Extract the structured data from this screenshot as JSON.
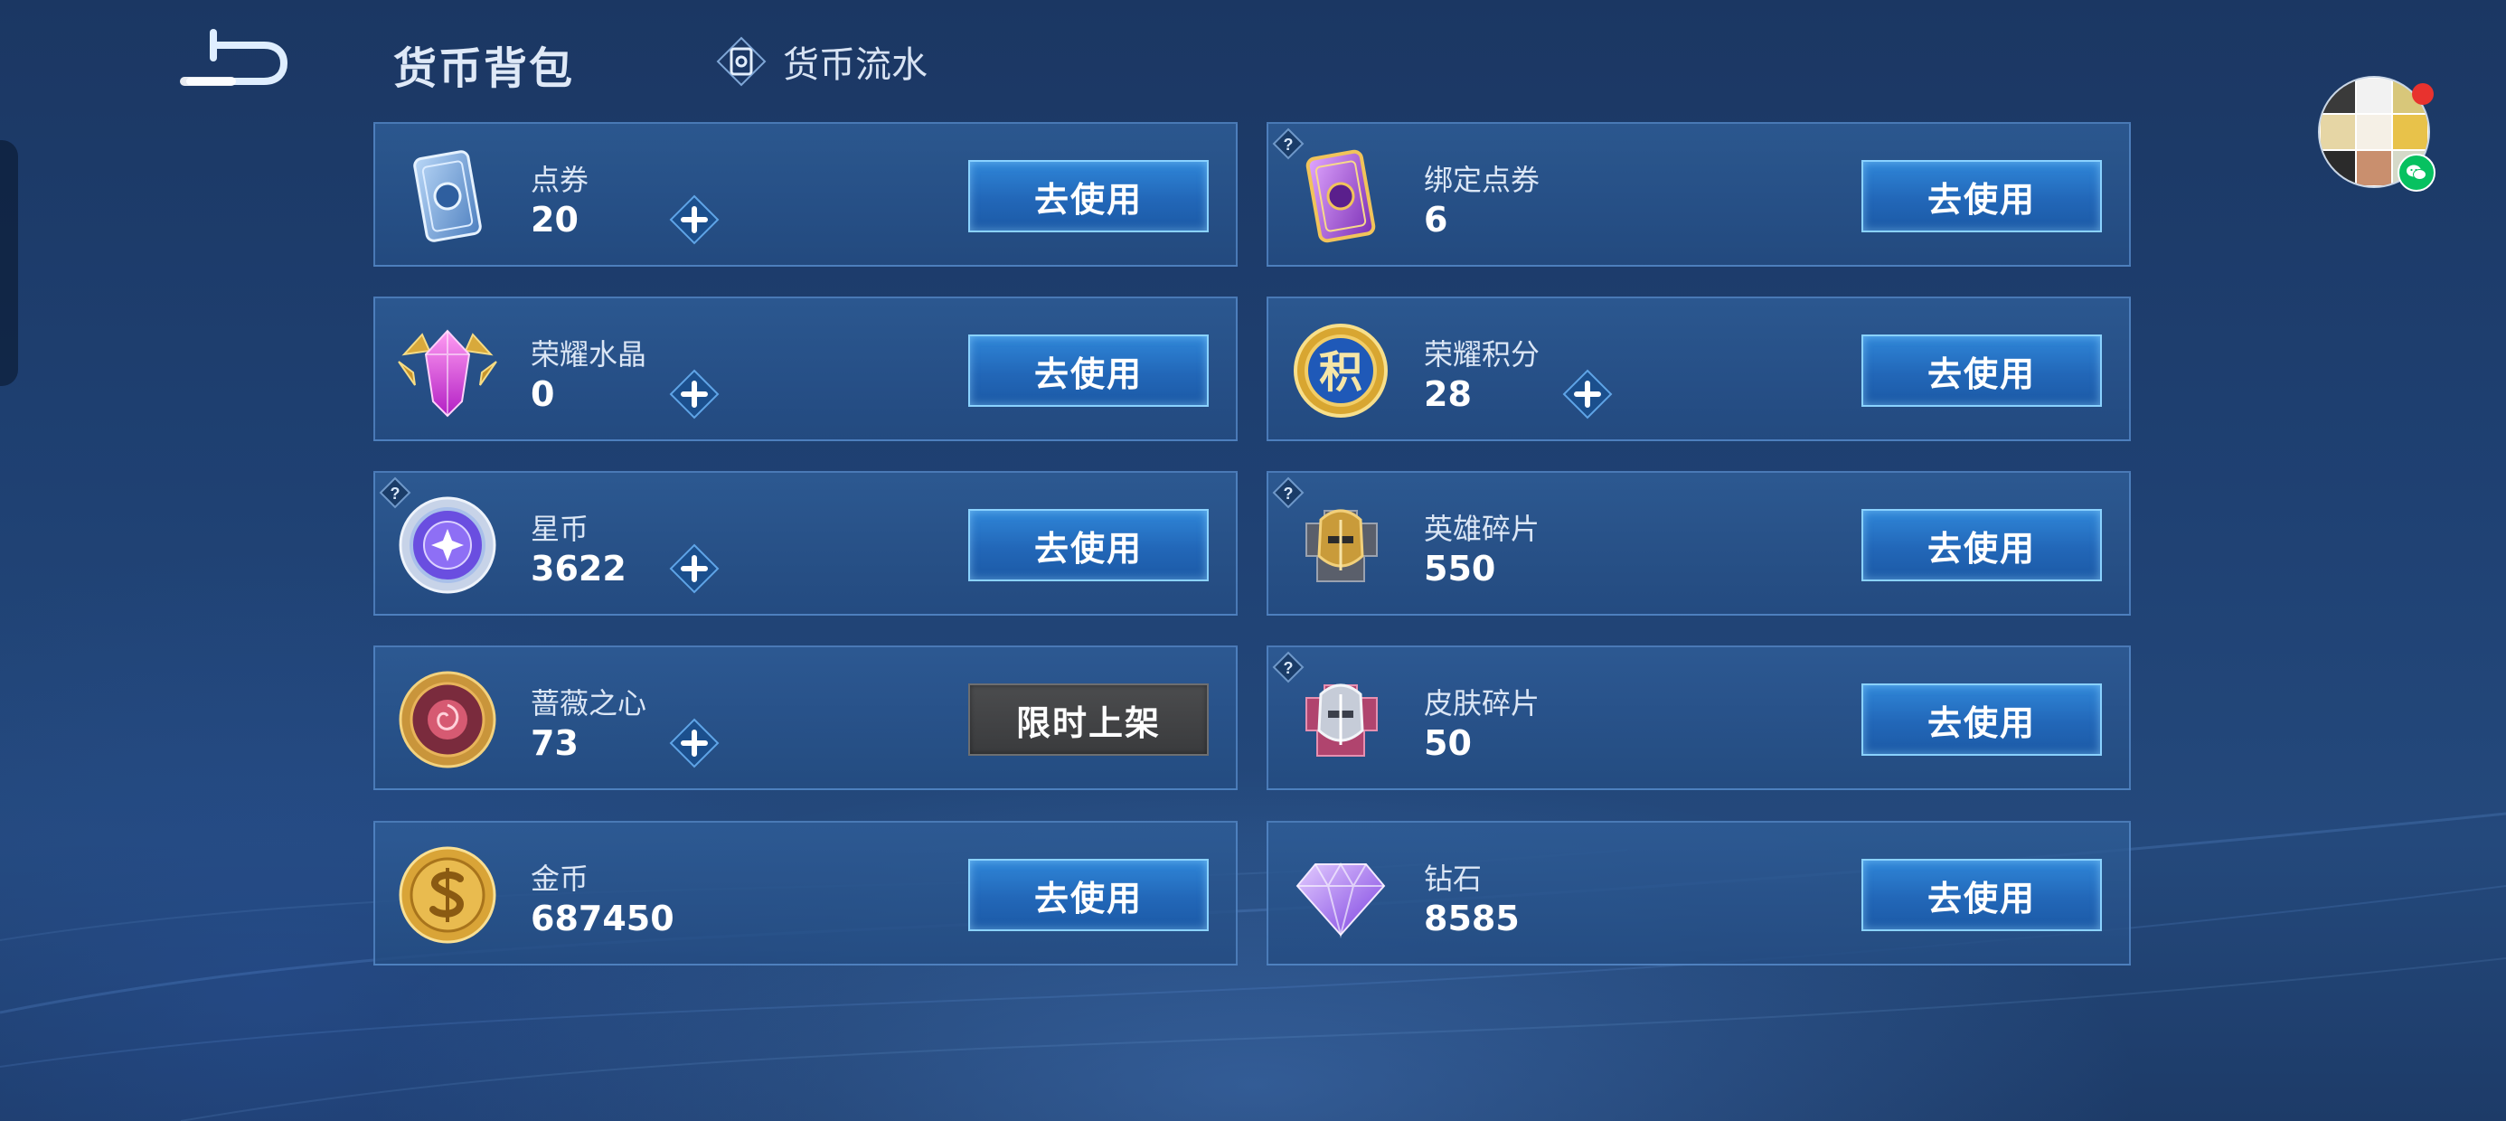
{
  "header": {
    "title": "货币背包",
    "ledger_label": "货币流水"
  },
  "colors": {
    "button_blue": "#2267b8",
    "button_border": "#8ad2ff",
    "limited_button": "#3a3b3d",
    "card_bg": "#2a5690",
    "notification_dot": "#e8322e",
    "wechat_green": "#07c160"
  },
  "currencies": [
    {
      "name": "点券",
      "amount": "20",
      "button": "去使用",
      "icon": "ticket-icon"
    },
    {
      "name": "绑定点券",
      "amount": "6",
      "button": "去使用",
      "icon": "bound-ticket-icon"
    },
    {
      "name": "荣耀水晶",
      "amount": "0",
      "button": "去使用",
      "icon": "glory-crystal-icon"
    },
    {
      "name": "荣耀积分",
      "amount": "28",
      "button": "去使用",
      "icon": "glory-points-icon"
    },
    {
      "name": "星币",
      "amount": "3622",
      "button": "去使用",
      "icon": "star-coin-icon"
    },
    {
      "name": "英雄碎片",
      "amount": "550",
      "button": "去使用",
      "icon": "hero-fragment-icon"
    },
    {
      "name": "蔷薇之心",
      "amount": "73",
      "button": "限时上架",
      "icon": "rose-heart-icon"
    },
    {
      "name": "皮肤碎片",
      "amount": "50",
      "button": "去使用",
      "icon": "skin-fragment-icon"
    },
    {
      "name": "金币",
      "amount": "687450",
      "button": "去使用",
      "icon": "gold-coin-icon"
    },
    {
      "name": "钻石",
      "amount": "8585",
      "button": "去使用",
      "icon": "diamond-icon"
    }
  ],
  "points_glyph": "积"
}
